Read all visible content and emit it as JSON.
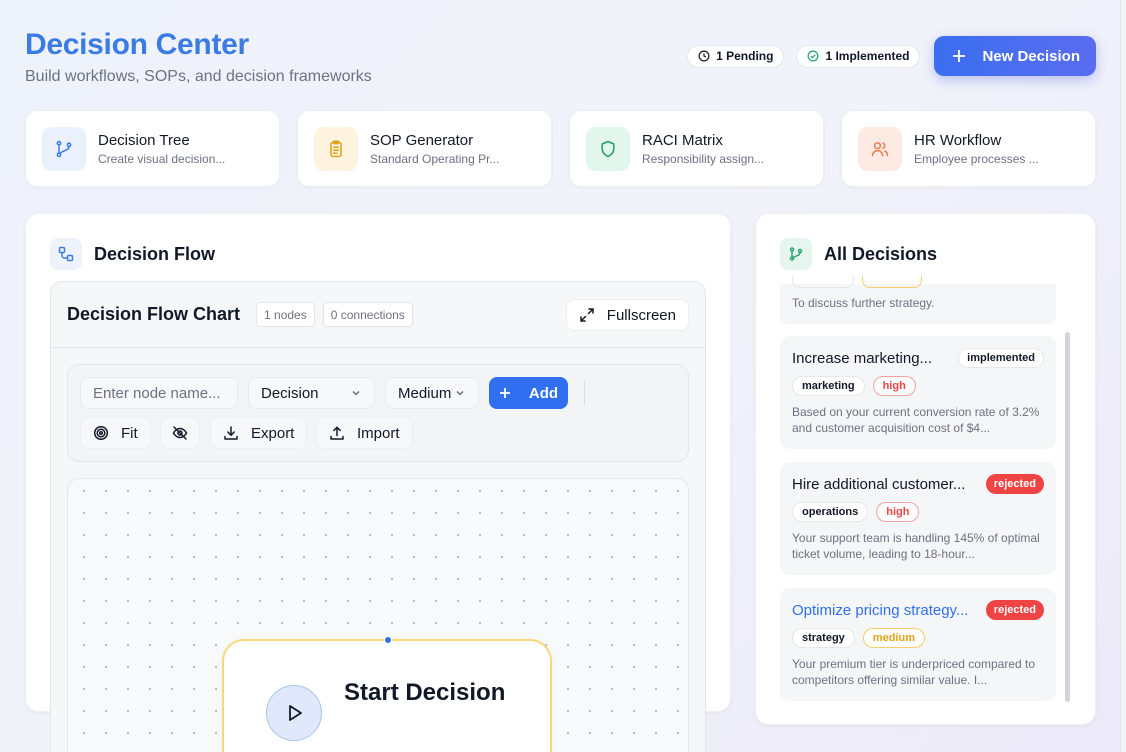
{
  "header": {
    "title": "Decision Center",
    "subtitle": "Build workflows, SOPs, and decision frameworks",
    "pending_label": "1 Pending",
    "implemented_label": "1 Implemented",
    "new_decision_label": "New Decision"
  },
  "tools": [
    {
      "name": "Decision Tree",
      "desc": "Create visual decision...",
      "icon": "branch-icon",
      "color": "#3b7be6",
      "bg": "#eaf0fc"
    },
    {
      "name": "SOP Generator",
      "desc": "Standard Operating Pr...",
      "icon": "clipboard-icon",
      "color": "#e0a21a",
      "bg": "#fdf3df"
    },
    {
      "name": "RACI Matrix",
      "desc": "Responsibility assign...",
      "icon": "shield-icon",
      "color": "#22a06b",
      "bg": "#e3f6ec"
    },
    {
      "name": "HR Workflow",
      "desc": "Employee processes ...",
      "icon": "users-icon",
      "color": "#ef7a4a",
      "bg": "#fdeae2"
    }
  ],
  "flow": {
    "panel_title": "Decision Flow",
    "chart_title": "Decision Flow Chart",
    "nodes_label": "1 nodes",
    "connections_label": "0 connections",
    "fullscreen_label": "Fullscreen",
    "node_name_placeholder": "Enter node name...",
    "type_value": "Decision",
    "priority_value": "Medium",
    "add_label": "Add",
    "fit_label": "Fit",
    "export_label": "Export",
    "import_label": "Import",
    "start_node_title": "Start Decision"
  },
  "decisions": {
    "panel_title": "All Decisions",
    "top_partial_desc": "To discuss further strategy.",
    "items": [
      {
        "title": "Increase marketing...",
        "status": "implemented",
        "category": "marketing",
        "priority": "high",
        "desc": "Based on your current conversion rate of 3.2% and customer acquisition cost of $4..."
      },
      {
        "title": "Hire additional customer...",
        "status": "rejected",
        "category": "operations",
        "priority": "high",
        "desc": "Your support team is handling 145% of optimal ticket volume, leading to 18-hour..."
      },
      {
        "title": "Optimize pricing strategy...",
        "status": "rejected",
        "category": "strategy",
        "priority": "medium",
        "desc": "Your premium tier is underpriced compared to competitors offering similar value. I..."
      }
    ]
  },
  "colors": {
    "accent": "#3b7be6",
    "primary_button": "#2f6ff0",
    "rejected": "#ef4444",
    "node_border": "#f8d97a"
  }
}
